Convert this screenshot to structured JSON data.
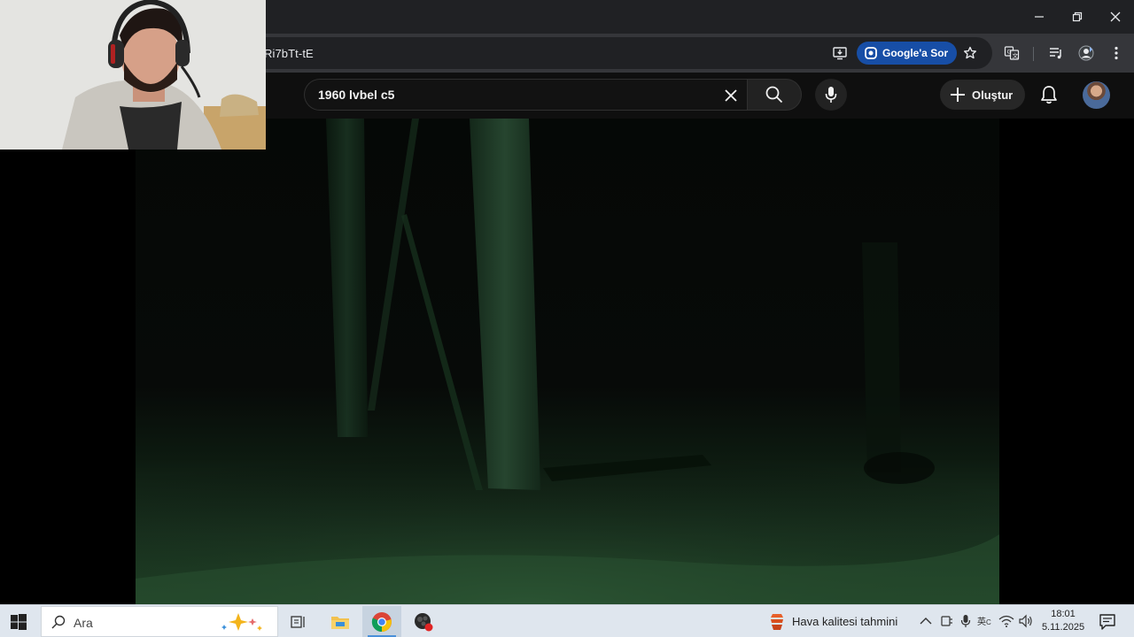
{
  "browser": {
    "url_fragment": "Ri7bTt-tE",
    "ask_google_label": "Google'a Sor"
  },
  "youtube": {
    "search_query": "1960 lvbel c5",
    "create_label": "Oluştur"
  },
  "taskbar": {
    "search_placeholder": "Ara",
    "weather_label": "Hava kalitesi tahmini",
    "clock_time": "18:01",
    "clock_date": "5.11.2025"
  },
  "colors": {
    "chrome_dark": "#202124",
    "ask_google_bg": "#174ea6",
    "youtube_bg": "#0f0f0f",
    "taskbar_bg": "#dfe6ee"
  }
}
